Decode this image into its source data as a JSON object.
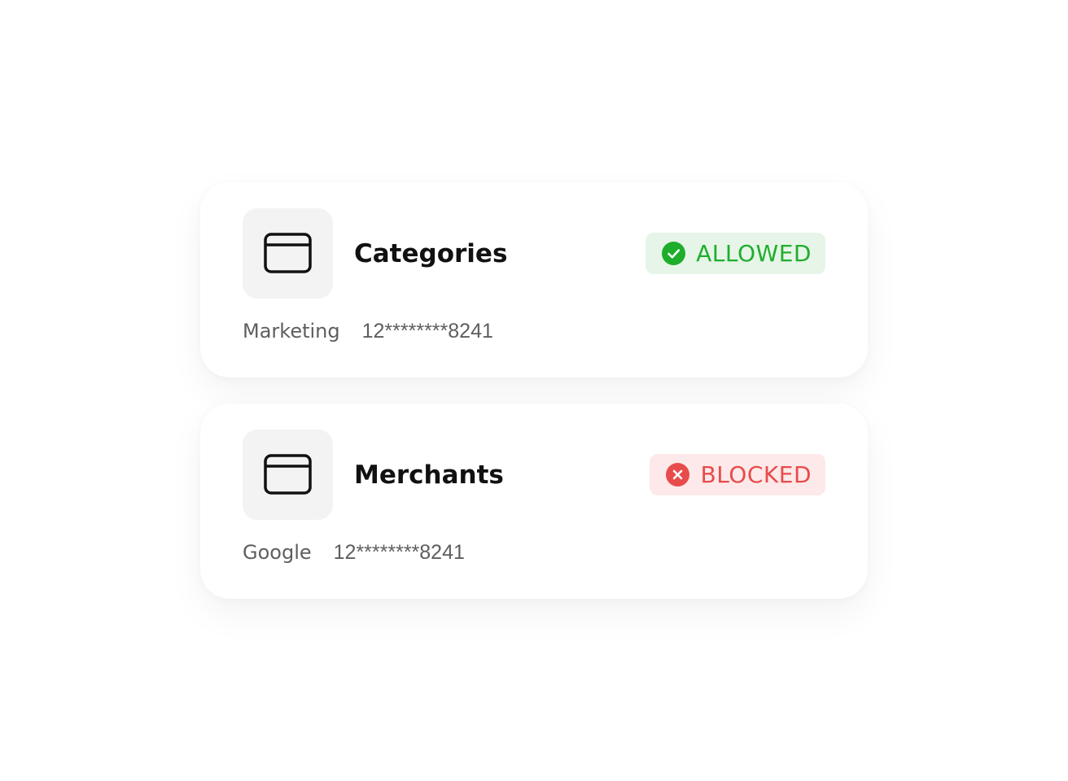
{
  "cards": [
    {
      "title": "Categories",
      "meta_label": "Marketing",
      "meta_number": "12********8241",
      "icon": "browser-window-icon",
      "status": {
        "label": "ALLOWED",
        "icon": "check-circle-icon",
        "color": "#1fae2c",
        "background": "#e7f5e8"
      }
    },
    {
      "title": "Merchants",
      "meta_label": "Google",
      "meta_number": "12********8241",
      "icon": "browser-window-icon",
      "status": {
        "label": "BLOCKED",
        "icon": "x-circle-icon",
        "color": "#e84b4b",
        "background": "#fde9e9"
      }
    }
  ]
}
